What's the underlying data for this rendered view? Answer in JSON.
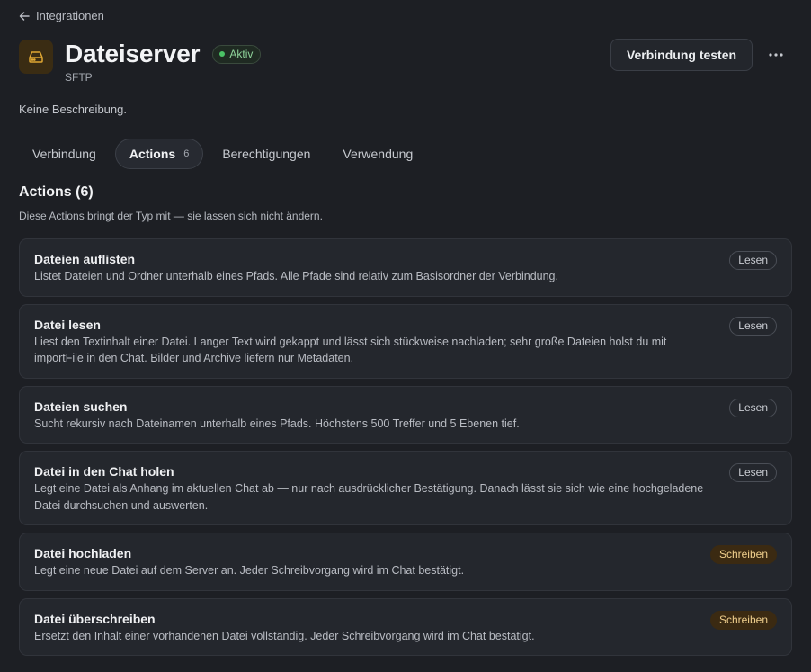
{
  "back": {
    "label": "Integrationen"
  },
  "header": {
    "title": "Dateiserver",
    "status": "Aktiv",
    "subtitle": "SFTP"
  },
  "toolbar": {
    "test_label": "Verbindung testen"
  },
  "description": "Keine Beschreibung.",
  "tabs": [
    {
      "label": "Verbindung"
    },
    {
      "label": "Actions",
      "count": "6"
    },
    {
      "label": "Berechtigungen"
    },
    {
      "label": "Verwendung"
    }
  ],
  "section": {
    "title": "Actions (6)",
    "description": "Diese Actions bringt der Typ mit — sie lassen sich nicht ändern."
  },
  "actions": [
    {
      "name": "Dateien auflisten",
      "description": "Listet Dateien und Ordner unterhalb eines Pfads. Alle Pfade sind relativ zum Basisordner der Verbindung.",
      "badge": "Lesen"
    },
    {
      "name": "Datei lesen",
      "description": "Liest den Textinhalt einer Datei. Langer Text wird gekappt und lässt sich stückweise nachladen; sehr große Dateien holst du mit importFile in den Chat. Bilder und Archive liefern nur Metadaten.",
      "badge": "Lesen"
    },
    {
      "name": "Dateien suchen",
      "description": "Sucht rekursiv nach Dateinamen unterhalb eines Pfads. Höchstens 500 Treffer und 5 Ebenen tief.",
      "badge": "Lesen"
    },
    {
      "name": "Datei in den Chat holen",
      "description": "Legt eine Datei als Anhang im aktuellen Chat ab — nur nach ausdrücklicher Bestätigung. Danach lässt sie sich wie eine hochgeladene Datei durchsuchen und auswerten.",
      "badge": "Lesen"
    },
    {
      "name": "Datei hochladen",
      "description": "Legt eine neue Datei auf dem Server an. Jeder Schreibvorgang wird im Chat bestätigt.",
      "badge": "Schreiben"
    },
    {
      "name": "Datei überschreiben",
      "description": "Ersetzt den Inhalt einer vorhandenen Datei vollständig. Jeder Schreibvorgang wird im Chat bestätigt.",
      "badge": "Schreiben"
    }
  ],
  "colors": {
    "background": "#1d1f24",
    "card": "#24272d",
    "accent_status": "#4bc266",
    "badge_write_bg": "#3b2a12",
    "badge_write_text": "#f0cf8d",
    "icon_tile": "#3a2c13",
    "icon_stroke": "#e0a733"
  },
  "icons": {
    "back": "arrow-left-icon",
    "app": "server-drive-icon",
    "more": "more-horizontal-icon"
  }
}
